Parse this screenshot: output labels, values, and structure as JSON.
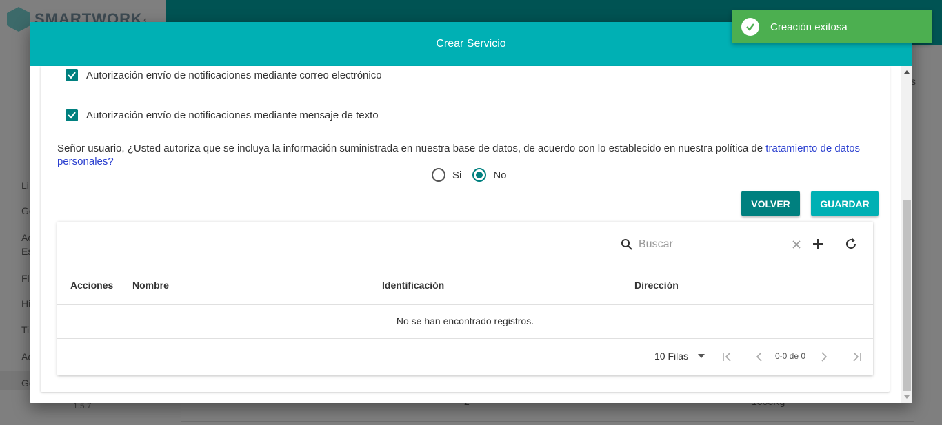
{
  "app": {
    "logo_text": "SMARTWORK",
    "version": "1.5.7",
    "sidebar_items": [
      "Li",
      "Ge",
      "Ac",
      "Es",
      "Fl",
      "Hi",
      "Ti",
      "Ac",
      "Ge"
    ],
    "background_texts": [
      "2",
      "1000Kg",
      "s"
    ]
  },
  "toast": {
    "message": "Creación exitosa",
    "icon": "check-circle-icon"
  },
  "modal": {
    "title": "Crear Servicio",
    "checkboxes": [
      {
        "label": "Autorización envío de notificaciones mediante correo electrónico",
        "checked": true
      },
      {
        "label": "Autorización envío de notificaciones mediante mensaje de texto",
        "checked": true
      }
    ],
    "consent": {
      "text": "Señor usuario, ¿Usted autoriza que se incluya la información suministrada en nuestra base de datos, de acuerdo con lo establecido en nuestra política de ",
      "link": "tratamiento de datos personales?"
    },
    "radio": {
      "options": [
        "Si",
        "No"
      ],
      "selected": "No"
    },
    "buttons": {
      "back": "VOLVER",
      "save": "GUARDAR"
    },
    "table": {
      "search_placeholder": "Buscar",
      "columns": [
        "Acciones",
        "Nombre",
        "Identificación",
        "Dirección"
      ],
      "empty_message": "No se han encontrado registros.",
      "rows_per_page": "10 Filas",
      "range": "0-0 de 0"
    }
  },
  "colors": {
    "header": "#00b0b4",
    "primary": "#00807f",
    "toast": "#4caf50",
    "link": "#2a3fcf"
  }
}
